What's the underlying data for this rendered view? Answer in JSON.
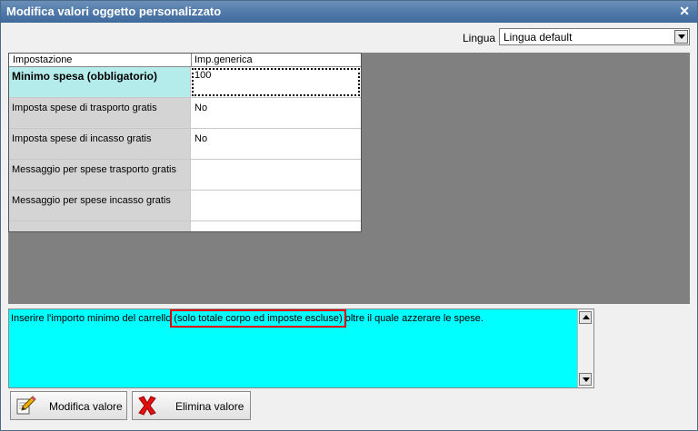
{
  "window": {
    "title": "Modifica valori oggetto personalizzato",
    "close_symbol": "✕"
  },
  "language": {
    "label": "Lingua :",
    "value": "Lingua default"
  },
  "grid": {
    "headers": [
      "Impostazione",
      "Imp.generica"
    ],
    "rows": [
      {
        "setting": "Minimo spesa (obbligatorio)",
        "value": "100"
      },
      {
        "setting": "Imposta spese di trasporto gratis",
        "value": "No"
      },
      {
        "setting": "Imposta spese di incasso gratis",
        "value": "No"
      },
      {
        "setting": "Messaggio per spese trasporto gratis",
        "value": ""
      },
      {
        "setting": "Messaggio per spese incasso gratis",
        "value": ""
      },
      {
        "setting": "",
        "value": ""
      }
    ]
  },
  "description": {
    "before": "Inserire l'importo minimo del carrello ",
    "highlight": "(solo totale corpo ed imposte escluse)",
    "after": " oltre il quale azzerare le spese."
  },
  "buttons": {
    "edit": "Modifica valore",
    "delete": "Elimina valore"
  },
  "icons": {
    "edit": "edit-pencil-icon",
    "delete": "red-x-icon"
  },
  "colors": {
    "description_bg": "#00ffff",
    "selected_row": "#b4ecec",
    "highlight_border": "#e00000",
    "titlebar": "#4d77a8"
  }
}
